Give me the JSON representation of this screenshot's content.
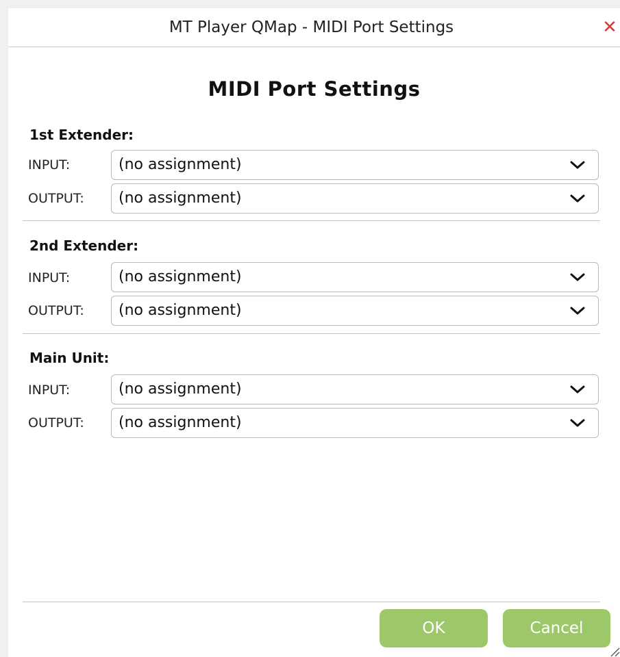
{
  "window": {
    "title": "MT Player QMap - MIDI Port Settings",
    "close_symbol": "✕"
  },
  "heading": "MIDI Port Settings",
  "sections": [
    {
      "title": "1st Extender:",
      "input_label": "INPUT:",
      "input_value": "(no assignment)",
      "output_label": "OUTPUT:",
      "output_value": "(no assignment)"
    },
    {
      "title": "2nd Extender:",
      "input_label": "INPUT:",
      "input_value": "(no assignment)",
      "output_label": "OUTPUT:",
      "output_value": "(no assignment)"
    },
    {
      "title": "Main Unit:",
      "input_label": "INPUT:",
      "input_value": "(no assignment)",
      "output_label": "OUTPUT:",
      "output_value": "(no assignment)"
    }
  ],
  "buttons": {
    "ok": "OK",
    "cancel": "Cancel"
  },
  "colors": {
    "button_green": "#9dc86a",
    "close_red": "#d23c3c"
  },
  "icons": {
    "close": "close-icon",
    "dropdown": "chevron-down-icon",
    "resize": "resize-grip-icon"
  }
}
